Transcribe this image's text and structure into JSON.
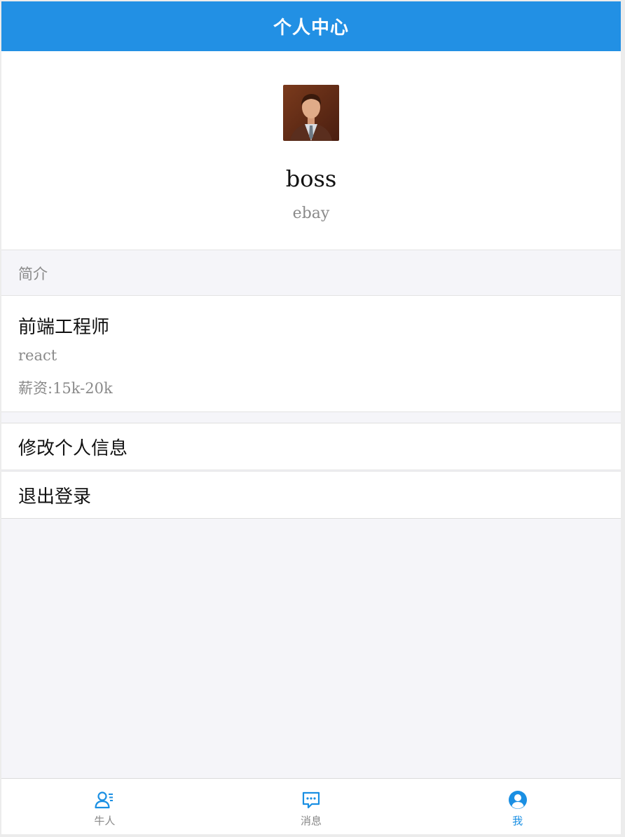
{
  "navbar": {
    "title": "个人中心"
  },
  "profile": {
    "avatar": "avatar-photo",
    "username": "boss",
    "company": "ebay"
  },
  "intro": {
    "header": "简介",
    "title": "前端工程师",
    "lines": [
      "react",
      "薪资:15k-20k"
    ]
  },
  "actions": {
    "edit_profile": "修改个人信息",
    "logout": "退出登录"
  },
  "tabbar": {
    "tabs": [
      {
        "label": "牛人",
        "icon": "user-list-icon",
        "active": false
      },
      {
        "label": "消息",
        "icon": "message-icon",
        "active": false
      },
      {
        "label": "我",
        "icon": "user-circle-icon",
        "active": true
      }
    ]
  },
  "colors": {
    "primary": "#2290e4",
    "active_tab": "#1a8fe3",
    "muted_text": "#8a8a8a",
    "background": "#f5f5f9"
  }
}
